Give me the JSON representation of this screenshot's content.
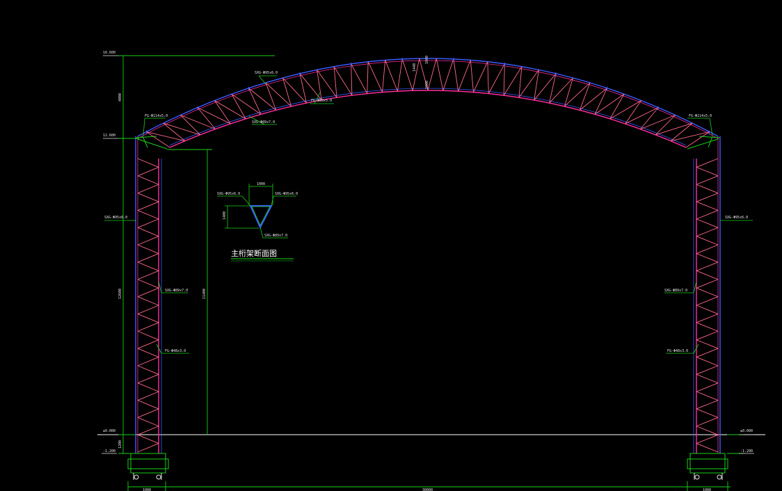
{
  "colors": {
    "background": "#000000",
    "chord_blue": "#3a5cff",
    "chord_magenta": "#ff2d9b",
    "web_pink": "#ff6a8a",
    "dimension_green": "#19d219",
    "text_white": "#e6e6e6",
    "ground_white": "#ffffff"
  },
  "elevations": {
    "top": "16.600",
    "eave": "12.600",
    "ground_left": "±0.000",
    "ground_right": "±0.000",
    "base_left": "-1.200",
    "base_right": "-1.200"
  },
  "dimensions": {
    "height_upper": "4000",
    "height_column": "12600",
    "height_inner": "11400",
    "depth_base": "1200",
    "span_total": "30000",
    "base_left_width": "1000",
    "base_right_width": "1000",
    "crown_depth": "1440",
    "crown_gap": "1000"
  },
  "member_labels": {
    "roof_top_chord": "SXG-Φ95x6.0",
    "roof_bottom_chord": "FG-Φ89x5.0",
    "roof_inner": "SXG-Φ89x7.0",
    "left_knee": "FG-Φ114x5.0",
    "right_knee": "FG-Φ114x5.0",
    "left_outer_chord": "SXG-Φ95x6.0",
    "left_inner_chord": "SXG-Φ89x7.0",
    "left_web": "FG-Φ48x3.0",
    "right_outer_chord": "SXG-Φ95x6.0",
    "right_inner_chord": "SXG-Φ89x7.0",
    "right_web": "FG-Φ48x3.0"
  },
  "section_detail": {
    "title": "主桁架断面图",
    "width": "1000",
    "height": "1400",
    "label_top_left": "SXG-Φ95x6.0",
    "label_top_right": "SXG-Φ95x6.0",
    "label_bottom": "SXG-Φ89x7.0"
  }
}
